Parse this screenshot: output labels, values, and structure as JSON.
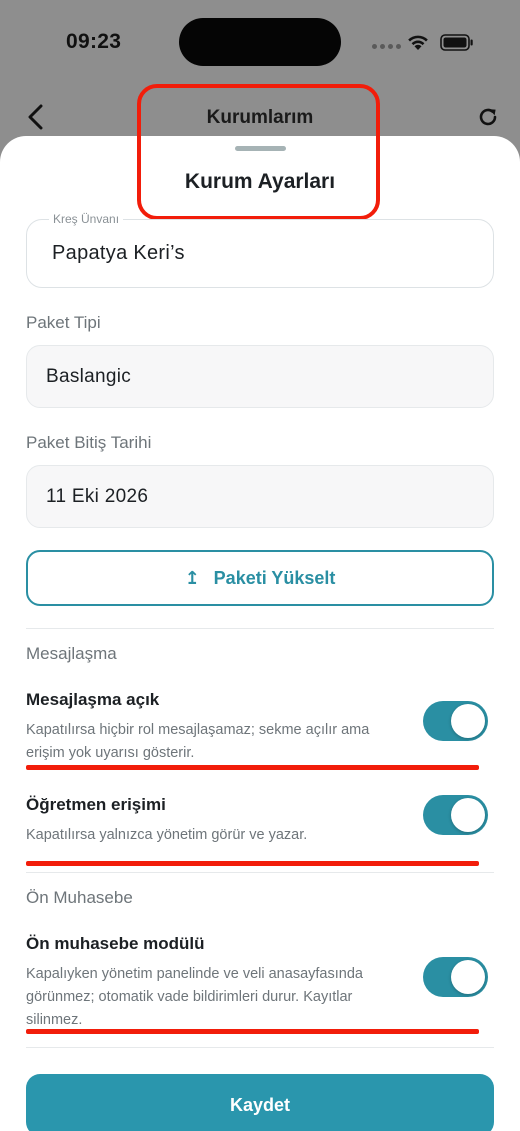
{
  "status_bar": {
    "time": "09:23"
  },
  "nav": {
    "title": "Kurumlarım"
  },
  "sheet": {
    "title": "Kurum Ayarları",
    "name_field": {
      "label": "Kreş Ünvanı",
      "value": "Papatya Keri’s"
    },
    "package_type": {
      "label": "Paket Tipi",
      "value": "Baslangic"
    },
    "package_end": {
      "label": "Paket Bitiş Tarihi",
      "value": "11 Eki 2026"
    },
    "upgrade_label": "Paketi Yükselt",
    "messaging": {
      "section": "Mesajlaşma",
      "items": [
        {
          "title": "Mesajlaşma açık",
          "desc": "Kapatılırsa hiçbir rol mesajlaşamaz; sekme açılır ama erişim yok uyarısı gösterir.",
          "on": true
        },
        {
          "title": "Öğretmen erişimi",
          "desc": "Kapatılırsa yalnızca yönetim görür ve yazar.",
          "on": true
        }
      ]
    },
    "accounting": {
      "section": "Ön Muhasebe",
      "items": [
        {
          "title": "Ön muhasebe modülü",
          "desc": "Kapalıyken yönetim panelinde ve veli anasayfasında görünmez; otomatik vade bildirimleri durur. Kayıtlar silinmez.",
          "on": true
        }
      ]
    },
    "save_label": "Kaydet"
  },
  "colors": {
    "accent": "#2a8fa3",
    "annotation": "#f21d0a"
  }
}
